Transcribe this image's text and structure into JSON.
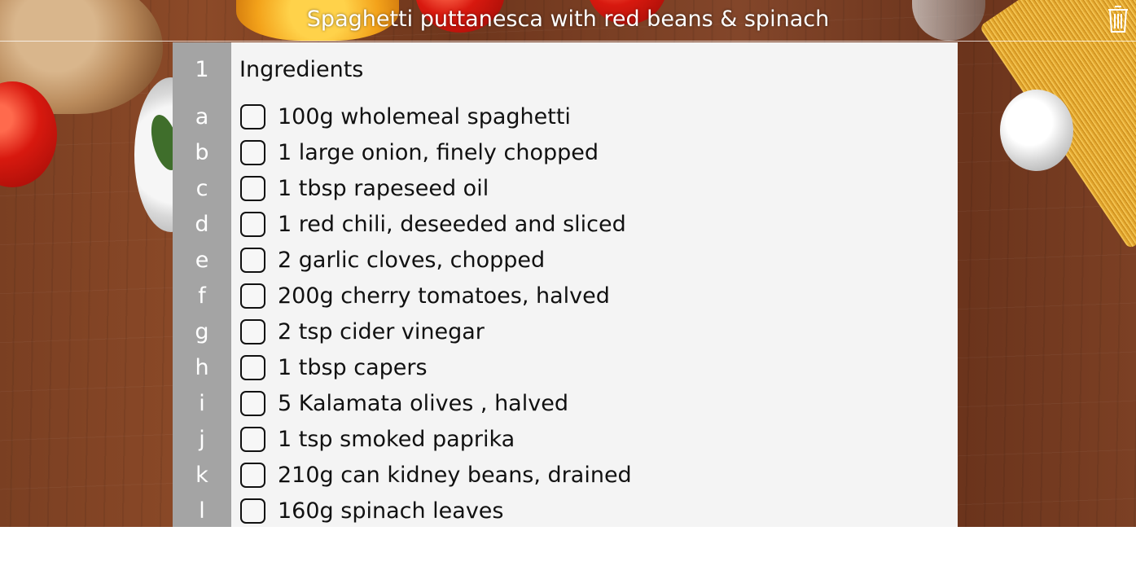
{
  "header": {
    "title": "Spaghetti puttanesca with red beans & spinach",
    "delete_icon": "trash-icon"
  },
  "section": {
    "number": "1",
    "heading": "Ingredients"
  },
  "ingredients": [
    {
      "letter": "a",
      "text": "100g wholemeal spaghetti",
      "checked": false
    },
    {
      "letter": "b",
      "text": "1 large onion, finely chopped",
      "checked": false
    },
    {
      "letter": "c",
      "text": "1 tbsp rapeseed oil",
      "checked": false
    },
    {
      "letter": "d",
      "text": "1 red chili, deseeded and sliced",
      "checked": false
    },
    {
      "letter": "e",
      "text": "2 garlic cloves, chopped",
      "checked": false
    },
    {
      "letter": "f",
      "text": "200g cherry tomatoes, halved",
      "checked": false
    },
    {
      "letter": "g",
      "text": "2 tsp cider vinegar",
      "checked": false
    },
    {
      "letter": "h",
      "text": "1 tbsp capers",
      "checked": false
    },
    {
      "letter": "i",
      "text": "5 Kalamata olives , halved",
      "checked": false
    },
    {
      "letter": "j",
      "text": "1 tsp smoked paprika",
      "checked": false
    },
    {
      "letter": "k",
      "text": "210g can kidney beans, drained",
      "checked": false
    },
    {
      "letter": "l",
      "text": "160g spinach leaves",
      "checked": false
    }
  ],
  "colors": {
    "gutter": "#a4a4a4",
    "panel": "#f4f4f4",
    "text": "#111111",
    "header_text": "#ffffff"
  }
}
